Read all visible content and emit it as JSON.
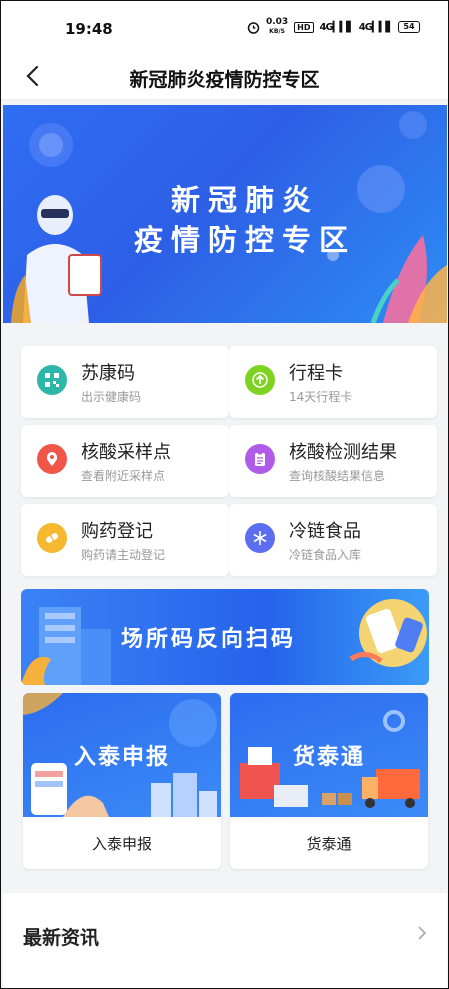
{
  "status": {
    "time": "19:48",
    "net_speed": "0.03",
    "net_unit": "KB/S",
    "hd": "HD",
    "sig1": "4G",
    "sig2": "4G",
    "battery": "54"
  },
  "nav": {
    "title": "新冠肺炎疫情防控专区"
  },
  "banner": {
    "line1": "新冠肺炎",
    "line2": "疫情防控专区"
  },
  "cards": [
    {
      "title": "苏康码",
      "sub": "出示健康码",
      "color": "#2cb7a8",
      "icon": "qr-code-icon"
    },
    {
      "title": "行程卡",
      "sub": "14天行程卡",
      "color": "#7ed321",
      "icon": "arrow-up-icon"
    },
    {
      "title": "核酸采样点",
      "sub": "查看附近采样点",
      "color": "#f0574a",
      "icon": "location-pin-icon"
    },
    {
      "title": "核酸检测结果",
      "sub": "查询核酸结果信息",
      "color": "#b05be8",
      "icon": "clipboard-icon"
    },
    {
      "title": "购药登记",
      "sub": "购药请主动登记",
      "color": "#f5b82e",
      "icon": "medicine-icon"
    },
    {
      "title": "冷链食品",
      "sub": "冷链食品入库",
      "color": "#5b6ef0",
      "icon": "snowflake-icon"
    }
  ],
  "scan": {
    "text": "场所码反向扫码"
  },
  "services": [
    {
      "banner_text": "入泰申报",
      "label": "入泰申报"
    },
    {
      "banner_text": "货泰通",
      "label": "货泰通"
    }
  ],
  "news": {
    "title": "最新资讯"
  }
}
